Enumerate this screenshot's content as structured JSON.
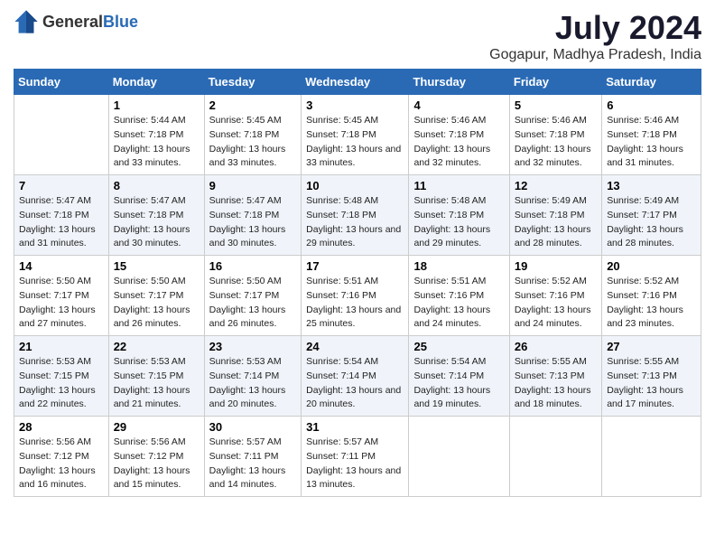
{
  "header": {
    "logo_general": "General",
    "logo_blue": "Blue",
    "title": "July 2024",
    "subtitle": "Gogapur, Madhya Pradesh, India"
  },
  "days_of_week": [
    "Sunday",
    "Monday",
    "Tuesday",
    "Wednesday",
    "Thursday",
    "Friday",
    "Saturday"
  ],
  "weeks": [
    [
      {
        "day": "",
        "sunrise": "",
        "sunset": "",
        "daylight": ""
      },
      {
        "day": "1",
        "sunrise": "Sunrise: 5:44 AM",
        "sunset": "Sunset: 7:18 PM",
        "daylight": "Daylight: 13 hours and 33 minutes."
      },
      {
        "day": "2",
        "sunrise": "Sunrise: 5:45 AM",
        "sunset": "Sunset: 7:18 PM",
        "daylight": "Daylight: 13 hours and 33 minutes."
      },
      {
        "day": "3",
        "sunrise": "Sunrise: 5:45 AM",
        "sunset": "Sunset: 7:18 PM",
        "daylight": "Daylight: 13 hours and 33 minutes."
      },
      {
        "day": "4",
        "sunrise": "Sunrise: 5:46 AM",
        "sunset": "Sunset: 7:18 PM",
        "daylight": "Daylight: 13 hours and 32 minutes."
      },
      {
        "day": "5",
        "sunrise": "Sunrise: 5:46 AM",
        "sunset": "Sunset: 7:18 PM",
        "daylight": "Daylight: 13 hours and 32 minutes."
      },
      {
        "day": "6",
        "sunrise": "Sunrise: 5:46 AM",
        "sunset": "Sunset: 7:18 PM",
        "daylight": "Daylight: 13 hours and 31 minutes."
      }
    ],
    [
      {
        "day": "7",
        "sunrise": "Sunrise: 5:47 AM",
        "sunset": "Sunset: 7:18 PM",
        "daylight": "Daylight: 13 hours and 31 minutes."
      },
      {
        "day": "8",
        "sunrise": "Sunrise: 5:47 AM",
        "sunset": "Sunset: 7:18 PM",
        "daylight": "Daylight: 13 hours and 30 minutes."
      },
      {
        "day": "9",
        "sunrise": "Sunrise: 5:47 AM",
        "sunset": "Sunset: 7:18 PM",
        "daylight": "Daylight: 13 hours and 30 minutes."
      },
      {
        "day": "10",
        "sunrise": "Sunrise: 5:48 AM",
        "sunset": "Sunset: 7:18 PM",
        "daylight": "Daylight: 13 hours and 29 minutes."
      },
      {
        "day": "11",
        "sunrise": "Sunrise: 5:48 AM",
        "sunset": "Sunset: 7:18 PM",
        "daylight": "Daylight: 13 hours and 29 minutes."
      },
      {
        "day": "12",
        "sunrise": "Sunrise: 5:49 AM",
        "sunset": "Sunset: 7:18 PM",
        "daylight": "Daylight: 13 hours and 28 minutes."
      },
      {
        "day": "13",
        "sunrise": "Sunrise: 5:49 AM",
        "sunset": "Sunset: 7:17 PM",
        "daylight": "Daylight: 13 hours and 28 minutes."
      }
    ],
    [
      {
        "day": "14",
        "sunrise": "Sunrise: 5:50 AM",
        "sunset": "Sunset: 7:17 PM",
        "daylight": "Daylight: 13 hours and 27 minutes."
      },
      {
        "day": "15",
        "sunrise": "Sunrise: 5:50 AM",
        "sunset": "Sunset: 7:17 PM",
        "daylight": "Daylight: 13 hours and 26 minutes."
      },
      {
        "day": "16",
        "sunrise": "Sunrise: 5:50 AM",
        "sunset": "Sunset: 7:17 PM",
        "daylight": "Daylight: 13 hours and 26 minutes."
      },
      {
        "day": "17",
        "sunrise": "Sunrise: 5:51 AM",
        "sunset": "Sunset: 7:16 PM",
        "daylight": "Daylight: 13 hours and 25 minutes."
      },
      {
        "day": "18",
        "sunrise": "Sunrise: 5:51 AM",
        "sunset": "Sunset: 7:16 PM",
        "daylight": "Daylight: 13 hours and 24 minutes."
      },
      {
        "day": "19",
        "sunrise": "Sunrise: 5:52 AM",
        "sunset": "Sunset: 7:16 PM",
        "daylight": "Daylight: 13 hours and 24 minutes."
      },
      {
        "day": "20",
        "sunrise": "Sunrise: 5:52 AM",
        "sunset": "Sunset: 7:16 PM",
        "daylight": "Daylight: 13 hours and 23 minutes."
      }
    ],
    [
      {
        "day": "21",
        "sunrise": "Sunrise: 5:53 AM",
        "sunset": "Sunset: 7:15 PM",
        "daylight": "Daylight: 13 hours and 22 minutes."
      },
      {
        "day": "22",
        "sunrise": "Sunrise: 5:53 AM",
        "sunset": "Sunset: 7:15 PM",
        "daylight": "Daylight: 13 hours and 21 minutes."
      },
      {
        "day": "23",
        "sunrise": "Sunrise: 5:53 AM",
        "sunset": "Sunset: 7:14 PM",
        "daylight": "Daylight: 13 hours and 20 minutes."
      },
      {
        "day": "24",
        "sunrise": "Sunrise: 5:54 AM",
        "sunset": "Sunset: 7:14 PM",
        "daylight": "Daylight: 13 hours and 20 minutes."
      },
      {
        "day": "25",
        "sunrise": "Sunrise: 5:54 AM",
        "sunset": "Sunset: 7:14 PM",
        "daylight": "Daylight: 13 hours and 19 minutes."
      },
      {
        "day": "26",
        "sunrise": "Sunrise: 5:55 AM",
        "sunset": "Sunset: 7:13 PM",
        "daylight": "Daylight: 13 hours and 18 minutes."
      },
      {
        "day": "27",
        "sunrise": "Sunrise: 5:55 AM",
        "sunset": "Sunset: 7:13 PM",
        "daylight": "Daylight: 13 hours and 17 minutes."
      }
    ],
    [
      {
        "day": "28",
        "sunrise": "Sunrise: 5:56 AM",
        "sunset": "Sunset: 7:12 PM",
        "daylight": "Daylight: 13 hours and 16 minutes."
      },
      {
        "day": "29",
        "sunrise": "Sunrise: 5:56 AM",
        "sunset": "Sunset: 7:12 PM",
        "daylight": "Daylight: 13 hours and 15 minutes."
      },
      {
        "day": "30",
        "sunrise": "Sunrise: 5:57 AM",
        "sunset": "Sunset: 7:11 PM",
        "daylight": "Daylight: 13 hours and 14 minutes."
      },
      {
        "day": "31",
        "sunrise": "Sunrise: 5:57 AM",
        "sunset": "Sunset: 7:11 PM",
        "daylight": "Daylight: 13 hours and 13 minutes."
      },
      {
        "day": "",
        "sunrise": "",
        "sunset": "",
        "daylight": ""
      },
      {
        "day": "",
        "sunrise": "",
        "sunset": "",
        "daylight": ""
      },
      {
        "day": "",
        "sunrise": "",
        "sunset": "",
        "daylight": ""
      }
    ]
  ]
}
